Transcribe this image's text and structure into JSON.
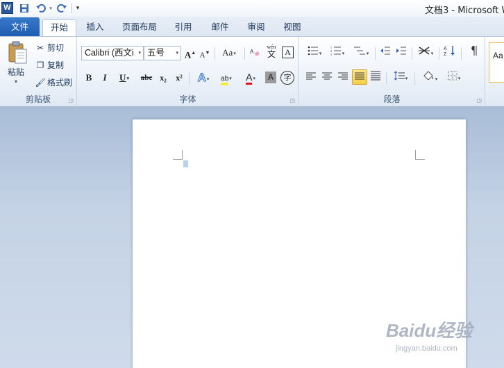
{
  "title_bar": {
    "app_icon": "W",
    "window_title": "文档3 - Microsoft W",
    "qat": {
      "save": "save-icon",
      "undo": "undo-icon",
      "redo": "redo-icon",
      "customize": "customize-icon"
    }
  },
  "tabs": [
    {
      "label": "文件"
    },
    {
      "label": "开始"
    },
    {
      "label": "插入"
    },
    {
      "label": "页面布局"
    },
    {
      "label": "引用"
    },
    {
      "label": "邮件"
    },
    {
      "label": "审阅"
    },
    {
      "label": "视图"
    }
  ],
  "ribbon": {
    "clipboard": {
      "group_label": "剪贴板",
      "paste_label": "粘贴",
      "cut_label": "剪切",
      "copy_label": "复制",
      "format_painter_label": "格式刷"
    },
    "font": {
      "group_label": "字体",
      "font_name": "Calibri (西文i",
      "font_size": "五号",
      "grow": "A",
      "shrink": "A",
      "change_case": "Aa",
      "phonetic": "wén",
      "bold": "B",
      "italic": "I",
      "underline": "U",
      "strikethrough": "abc",
      "subscript": "x₂",
      "superscript": "x²",
      "highlight": "ab",
      "font_color": "A",
      "char_shading": "A",
      "enclose": "字"
    },
    "paragraph": {
      "group_label": "段落"
    },
    "styles": {
      "preview": "Aa"
    }
  },
  "watermark": {
    "logo": "Baidu经验",
    "url": "jingyan.baidu.com"
  },
  "colors": {
    "file_tab": "#2b62b8",
    "accent_highlight": "#f8cf47",
    "font_color_bar": "#e01010"
  }
}
